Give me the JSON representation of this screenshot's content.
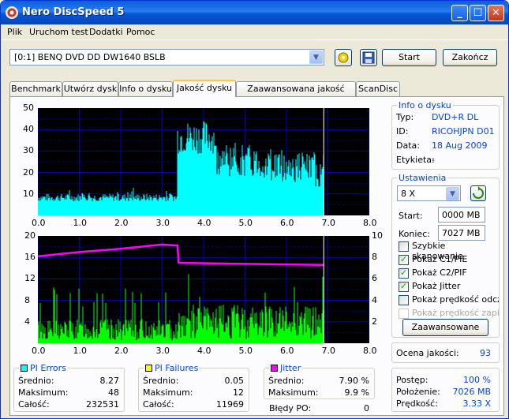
{
  "window": {
    "title": "Nero DiscSpeed 5"
  },
  "menu": [
    "Plik",
    "Uruchom test",
    "Dodatki",
    "Pomoc"
  ],
  "toolbar": {
    "drive": "[0:1]   BENQ DVD DD DW1640 BSLB",
    "start": "Start",
    "end": "Zakończ"
  },
  "tabs": [
    "Benchmark",
    "Utwórz dysk",
    "Info o dysku",
    "Jakość dysku",
    "Zaawansowana jakość dysku",
    "ScanDisc"
  ],
  "active_tab": "Jakość dysku",
  "disc_info": {
    "title": "Info o dysku",
    "type_label": "Typ:",
    "type": "DVD+R DL",
    "id_label": "ID:",
    "id": "RICOHJPN D01",
    "date_label": "Data:",
    "date": "18 Aug 2009",
    "label_label": "Etykieta:",
    "label": "-"
  },
  "settings": {
    "title": "Ustawienia",
    "speed": "8 X",
    "start_label": "Start:",
    "start": "0000 MB",
    "end_label": "Koniec:",
    "end": "7027 MB",
    "quick_scan": "Szybkie skanowanie",
    "show_c1": "Pokaż C1/PIE",
    "show_c2": "Pokaż C2/PIF",
    "show_jitter": "Pokaż Jitter",
    "show_read_speed": "Pokaż prędkość odczy",
    "show_write_speed": "Pokaż prędkość zapisu",
    "advanced": "Zaawansowane"
  },
  "quality": {
    "label": "Ocena jakości:",
    "value": "93"
  },
  "progress": {
    "progress_label": "Postęp:",
    "progress": "100 %",
    "position_label": "Położenie:",
    "position": "7026 MB",
    "speed_label": "Prędkość:",
    "speed": "3.33 X"
  },
  "pi_errors": {
    "title": "PI Errors",
    "color": "#00ffff",
    "avg_label": "Średnio:",
    "avg": "8.27",
    "max_label": "Maksimum:",
    "max": "48",
    "total_label": "Całość:",
    "total": "232531"
  },
  "pi_failures": {
    "title": "PI Failures",
    "color": "#ffff00",
    "avg_label": "Średnio:",
    "avg": "0.05",
    "max_label": "Maksimum:",
    "max": "12",
    "total_label": "Całość:",
    "total": "11969"
  },
  "jitter": {
    "title": "Jitter",
    "color": "#ff00ff",
    "avg_label": "Średnio:",
    "avg": "7.90 %",
    "max_label": "Maksimum:",
    "max": "9.9 %"
  },
  "po_errors": {
    "label": "Błędy PO:",
    "value": "0"
  },
  "chart_data": [
    {
      "type": "area",
      "series": [
        {
          "name": "PI Errors",
          "color": "#00ffff"
        }
      ],
      "x_ticks": [
        "0.0",
        "1.0",
        "2.0",
        "3.0",
        "4.0",
        "5.0",
        "6.0",
        "7.0",
        "8.0"
      ],
      "y_ticks": [
        "10",
        "20",
        "30",
        "40",
        "50"
      ],
      "xlim": [
        0,
        8
      ],
      "ylim": [
        0,
        50
      ],
      "segments": [
        {
          "x": [
            0,
            3.37
          ],
          "level": 8
        },
        {
          "x": [
            3.37,
            4.3
          ],
          "level": 35
        },
        {
          "x": [
            4.3,
            6.9
          ],
          "level": 27
        }
      ],
      "marker_x": 6.9
    },
    {
      "type": "bar",
      "series": [
        {
          "name": "PI Failures",
          "color": "#00ff00"
        },
        {
          "name": "Jitter",
          "color": "#ff00ff"
        }
      ],
      "x_ticks": [
        "0.0",
        "1.0",
        "2.0",
        "3.0",
        "4.0",
        "5.0",
        "6.0",
        "7.0",
        "8.0"
      ],
      "y_ticks_left": [
        "4",
        "8",
        "12",
        "16",
        "20"
      ],
      "y_ticks_right": [
        "2",
        "4",
        "6",
        "8",
        "10"
      ],
      "xlim": [
        0,
        8
      ],
      "ylim_left": [
        0,
        20
      ],
      "ylim_right": [
        0,
        10
      ],
      "jitter": [
        {
          "x": 0,
          "y": 8.1
        },
        {
          "x": 1,
          "y": 8.5
        },
        {
          "x": 2,
          "y": 8.8
        },
        {
          "x": 3,
          "y": 9.2
        },
        {
          "x": 3.37,
          "y": 9.1
        },
        {
          "x": 3.4,
          "y": 7.5
        },
        {
          "x": 5,
          "y": 7.4
        },
        {
          "x": 6.9,
          "y": 7.3
        }
      ],
      "marker_x": 6.9
    }
  ]
}
